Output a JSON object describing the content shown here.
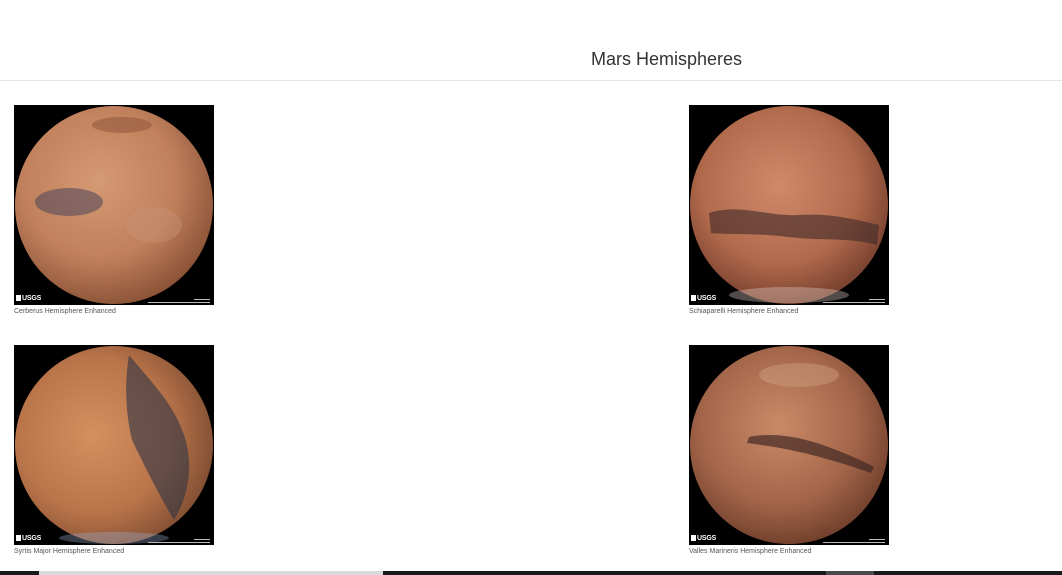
{
  "page": {
    "title": "Mars Hemispheres"
  },
  "hemispheres": [
    {
      "title": "Cerberus Hemisphere Enhanced",
      "logo_text": "USGS",
      "colors": {
        "light": "#d49a74",
        "mid": "#c0805c",
        "dark": "#8a5236",
        "feature": "#4a4458"
      }
    },
    {
      "title": "Schiaparelli Hemisphere Enhanced",
      "logo_text": "USGS",
      "colors": {
        "light": "#d08a6a",
        "mid": "#b26a4c",
        "dark": "#6e3a2a",
        "feature": "#3e2a28"
      }
    },
    {
      "title": "Syrtis Major Hemisphere Enhanced",
      "logo_text": "USGS",
      "colors": {
        "light": "#d49060",
        "mid": "#b9744a",
        "dark": "#7a4a30",
        "feature": "#2e3444"
      }
    },
    {
      "title": "Valles Marineris Hemisphere Enhanced",
      "logo_text": "USGS",
      "colors": {
        "light": "#c88a66",
        "mid": "#a4664a",
        "dark": "#6a3a28",
        "feature": "#3a2420"
      }
    }
  ]
}
